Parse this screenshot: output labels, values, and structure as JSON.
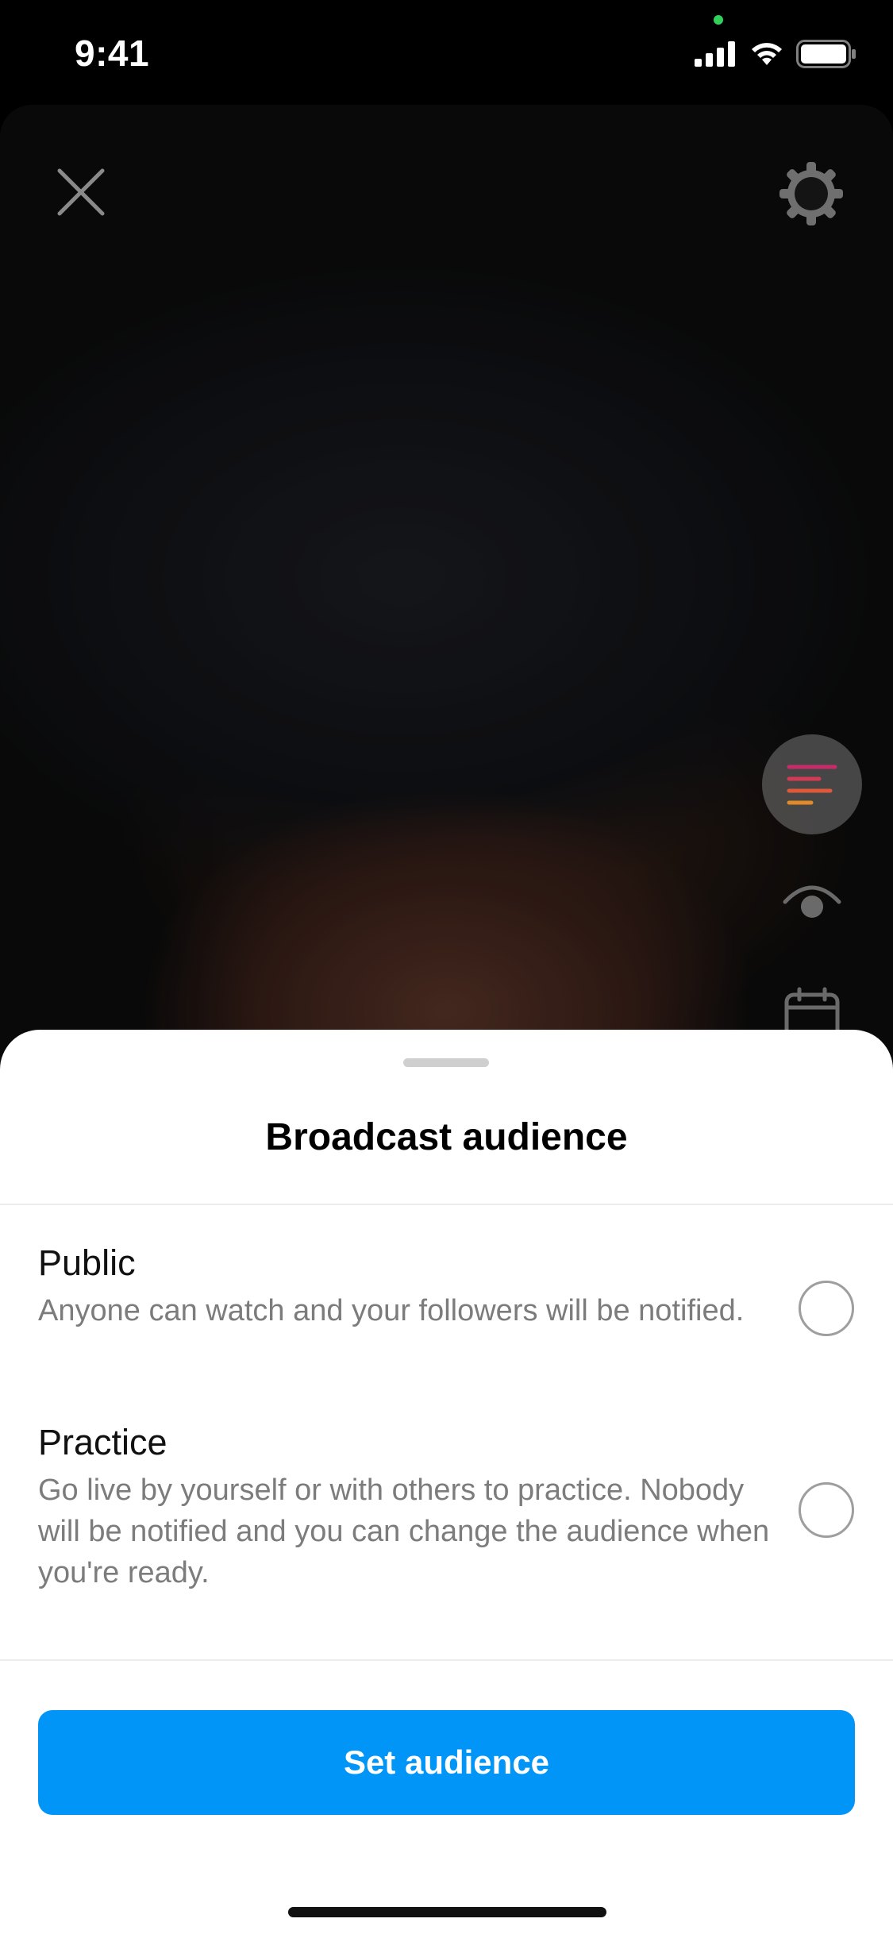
{
  "status_bar": {
    "time": "9:41",
    "icons": [
      "cellular-signal-icon",
      "wifi-icon",
      "battery-icon"
    ]
  },
  "camera": {
    "controls": [
      "close-icon",
      "settings-gear-icon",
      "comments-icon",
      "eye-icon",
      "calendar-icon"
    ]
  },
  "sheet": {
    "title": "Broadcast audience",
    "options": [
      {
        "title": "Public",
        "description": "Anyone can watch and your followers will be notified.",
        "selected": false
      },
      {
        "title": "Practice",
        "description": "Go live by yourself or with others to practice. Nobody will be notified and you can change the audience when you're ready.",
        "selected": false
      }
    ],
    "button_label": "Set audience"
  },
  "colors": {
    "accent": "#0095f6",
    "sheet_background": "#ffffff",
    "description_text": "#7c7c7c"
  }
}
